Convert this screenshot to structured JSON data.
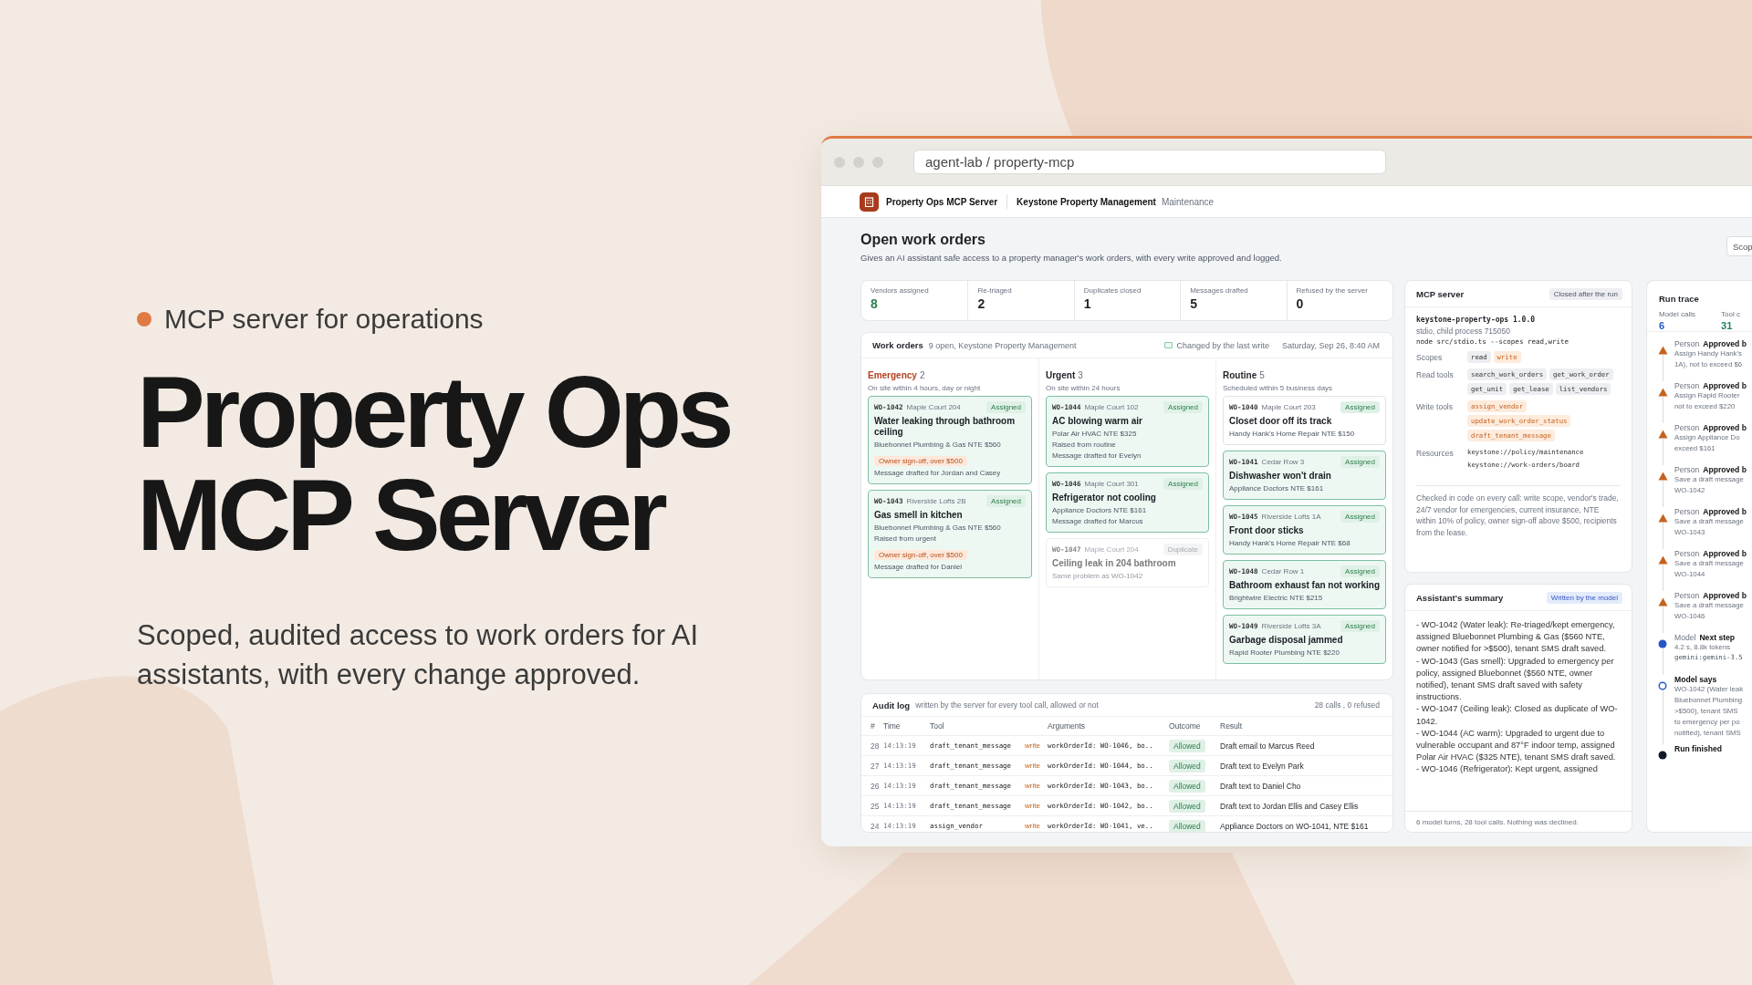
{
  "hero": {
    "eyebrow": "MCP server for operations",
    "title": "Property Ops MCP Server",
    "subtitle": "Scoped, audited access to work orders for AI assistants, with every change approved."
  },
  "window": {
    "url": "agent-lab / property-mcp"
  },
  "app_header": {
    "brand": "Property Ops MCP Server",
    "organization": "Keystone Property Management",
    "section": "Maintenance"
  },
  "page": {
    "title": "Open work orders",
    "description": "Gives an AI assistant safe access to a property manager's work orders, with every write approved and logged.",
    "scope_button": "Scop"
  },
  "stats": [
    {
      "label": "Vendors assigned",
      "value": "8",
      "color": "#2e7d4f"
    },
    {
      "label": "Re-triaged",
      "value": "2",
      "color": "#1f2329"
    },
    {
      "label": "Duplicates closed",
      "value": "1",
      "color": "#1f2329"
    },
    {
      "label": "Messages drafted",
      "value": "5",
      "color": "#1f2329"
    },
    {
      "label": "Refused by the server",
      "value": "0",
      "color": "#1f2329"
    }
  ],
  "work_orders": {
    "title": "Work orders",
    "summary": "9 open, Keystone Property Management",
    "legend": "Changed by the last write",
    "date": "Saturday, Sep 26, 8:40 AM",
    "columns": [
      {
        "name": "Emergency",
        "count": "2",
        "note": "On site within 4 hours, day or night",
        "color": "#b3401f",
        "cards": [
          {
            "id": "WO-1042",
            "location": "Maple Court 204",
            "status": "Assigned",
            "duplicate": false,
            "changed": true,
            "title": "Water leaking through bathroom ceiling",
            "lines": [
              {
                "kind": "text",
                "text": "Bluebonnet Plumbing & Gas NTE $560"
              },
              {
                "kind": "flag",
                "text": "Owner sign-off, over $500"
              },
              {
                "kind": "text",
                "text": "Message drafted for Jordan and Casey"
              }
            ]
          },
          {
            "id": "WO-1043",
            "location": "Riverside Lofts 2B",
            "status": "Assigned",
            "duplicate": false,
            "changed": true,
            "title": "Gas smell in kitchen",
            "lines": [
              {
                "kind": "text",
                "text": "Bluebonnet Plumbing & Gas NTE $560"
              },
              {
                "kind": "text",
                "text": "Raised from urgent"
              },
              {
                "kind": "flag",
                "text": "Owner sign-off, over $500"
              },
              {
                "kind": "text",
                "text": "Message drafted for Daniel"
              }
            ]
          }
        ]
      },
      {
        "name": "Urgent",
        "count": "3",
        "note": "On site within 24 hours",
        "color": "#1f2329",
        "cards": [
          {
            "id": "WO-1044",
            "location": "Maple Court 102",
            "status": "Assigned",
            "duplicate": false,
            "changed": true,
            "title": "AC blowing warm air",
            "lines": [
              {
                "kind": "text",
                "text": "Polar Air HVAC NTE $325"
              },
              {
                "kind": "text",
                "text": "Raised from routine"
              },
              {
                "kind": "text",
                "text": "Message drafted for Evelyn"
              }
            ]
          },
          {
            "id": "WO-1046",
            "location": "Maple Court 301",
            "status": "Assigned",
            "duplicate": false,
            "changed": true,
            "title": "Refrigerator not cooling",
            "lines": [
              {
                "kind": "text",
                "text": "Appliance Doctors NTE $161"
              },
              {
                "kind": "text",
                "text": "Message drafted for Marcus"
              }
            ]
          },
          {
            "id": "WO-1047",
            "location": "Maple Court 204",
            "status": "Duplicate",
            "duplicate": true,
            "changed": false,
            "title": "Ceiling leak in 204 bathroom",
            "lines": [
              {
                "kind": "text",
                "text": "Same problem as WO-1042"
              }
            ]
          }
        ]
      },
      {
        "name": "Routine",
        "count": "5",
        "note": "Scheduled within 5 business days",
        "color": "#1f2329",
        "cards": [
          {
            "id": "WO-1040",
            "location": "Maple Court 203",
            "status": "Assigned",
            "duplicate": false,
            "changed": false,
            "title": "Closet door off its track",
            "lines": [
              {
                "kind": "text",
                "text": "Handy Hank's Home Repair NTE $150"
              }
            ]
          },
          {
            "id": "WO-1041",
            "location": "Cedar Row 3",
            "status": "Assigned",
            "duplicate": false,
            "changed": true,
            "title": "Dishwasher won't drain",
            "lines": [
              {
                "kind": "text",
                "text": "Appliance Doctors NTE $161"
              }
            ]
          },
          {
            "id": "WO-1045",
            "location": "Riverside Lofts 1A",
            "status": "Assigned",
            "duplicate": false,
            "changed": true,
            "title": "Front door sticks",
            "lines": [
              {
                "kind": "text",
                "text": "Handy Hank's Home Repair NTE $68"
              }
            ]
          },
          {
            "id": "WO-1048",
            "location": "Cedar Row 1",
            "status": "Assigned",
            "duplicate": false,
            "changed": true,
            "title": "Bathroom exhaust fan not working",
            "lines": [
              {
                "kind": "text",
                "text": "Brightwire Electric NTE $215"
              }
            ]
          },
          {
            "id": "WO-1049",
            "location": "Riverside Lofts 3A",
            "status": "Assigned",
            "duplicate": false,
            "changed": true,
            "title": "Garbage disposal jammed",
            "lines": [
              {
                "kind": "text",
                "text": "Rapid Rooter Plumbing NTE $220"
              }
            ]
          }
        ]
      }
    ]
  },
  "audit_log": {
    "title": "Audit log",
    "subtitle": "written by the server for every tool call, allowed or not",
    "counts": "28 calls , 0 refused",
    "columns": [
      "#",
      "Time",
      "Tool",
      "Arguments",
      "Outcome",
      "Result"
    ],
    "rows": [
      {
        "number": "28",
        "time": "14:13:19",
        "tool": "draft_tenant_message",
        "scope": "write",
        "arguments": "workOrderId: WO-1046, bo..",
        "outcome": "Allowed",
        "result": "Draft email to Marcus Reed"
      },
      {
        "number": "27",
        "time": "14:13:19",
        "tool": "draft_tenant_message",
        "scope": "write",
        "arguments": "workOrderId: WO-1044, bo..",
        "outcome": "Allowed",
        "result": "Draft text to Evelyn Park"
      },
      {
        "number": "26",
        "time": "14:13:19",
        "tool": "draft_tenant_message",
        "scope": "write",
        "arguments": "workOrderId: WO-1043, bo..",
        "outcome": "Allowed",
        "result": "Draft text to Daniel Cho"
      },
      {
        "number": "25",
        "time": "14:13:19",
        "tool": "draft_tenant_message",
        "scope": "write",
        "arguments": "workOrderId: WO-1042, bo..",
        "outcome": "Allowed",
        "result": "Draft text to Jordan Ellis and Casey Ellis"
      },
      {
        "number": "24",
        "time": "14:13:19",
        "tool": "assign_vendor",
        "scope": "write",
        "arguments": "workOrderId: WO-1041, ve..",
        "outcome": "Allowed",
        "result": "Appliance Doctors on WO-1041, NTE $161"
      }
    ]
  },
  "mcp_server": {
    "title": "MCP server",
    "badge": "Closed after the run",
    "name": "keystone-property-ops 1.0.0",
    "process": "stdio, child process 715050",
    "command": "node src/stdio.ts --scopes read,write",
    "rows": [
      {
        "label": "Scopes",
        "items": [
          {
            "text": "read",
            "kind": "read"
          },
          {
            "text": "write",
            "kind": "write"
          }
        ]
      },
      {
        "label": "Read tools",
        "items": [
          {
            "text": "search_work_orders",
            "kind": "read"
          },
          {
            "text": "get_work_order",
            "kind": "read"
          },
          {
            "text": "get_unit",
            "kind": "read"
          },
          {
            "text": "get_lease",
            "kind": "read"
          },
          {
            "text": "list_vendors",
            "kind": "read"
          }
        ]
      },
      {
        "label": "Write tools",
        "items": [
          {
            "text": "assign_vendor",
            "kind": "write"
          },
          {
            "text": "update_work_order_status",
            "kind": "write"
          },
          {
            "text": "draft_tenant_message",
            "kind": "write"
          }
        ]
      },
      {
        "label": "Resources",
        "items": [
          {
            "text": "keystone://policy/maintenance",
            "kind": "plain"
          },
          {
            "text": "keystone://work-orders/board",
            "kind": "plain"
          }
        ]
      }
    ],
    "note": "Checked in code on every call: write scope, vendor's trade, 24/7 vendor for emergencies, current insurance, NTE within 10% of policy, owner sign-off above $500, recipients from the lease."
  },
  "summary": {
    "title": "Assistant's summary",
    "badge": "Written by the model",
    "lines": [
      "- WO-1042 (Water leak): Re-triaged/kept emergency, assigned Bluebonnet Plumbing & Gas ($560 NTE, owner notified for >$500), tenant SMS draft saved.",
      "- WO-1043 (Gas smell): Upgraded to emergency per policy, assigned Bluebonnet ($560 NTE, owner notified), tenant SMS draft saved with safety instructions.",
      "- WO-1047 (Ceiling leak): Closed as duplicate of WO-1042.",
      "- WO-1044 (AC warm): Upgraded to urgent due to vulnerable occupant and 87°F indoor temp, assigned Polar Air HVAC ($325 NTE), tenant SMS draft saved.",
      "- WO-1046 (Refrigerator): Kept urgent, assigned"
    ],
    "footer": "6 model turns, 28 tool calls. Nothing was declined."
  },
  "run_trace": {
    "title": "Run trace",
    "stats": [
      {
        "label": "Model calls",
        "value": "6",
        "color": "#2456c8"
      },
      {
        "label": "Tool c",
        "value": "31",
        "color": "#23806a"
      }
    ],
    "items": [
      {
        "kind": "person",
        "label": "Person",
        "title": "Approved b",
        "details": [
          "Assign Handy Hank's",
          "1A), not to exceed $6"
        ]
      },
      {
        "kind": "person",
        "label": "Person",
        "title": "Approved b",
        "details": [
          "Assign Rapid Rooter",
          "not to exceed $220"
        ]
      },
      {
        "kind": "person",
        "label": "Person",
        "title": "Approved b",
        "details": [
          "Assign Appliance Do",
          "exceed $161"
        ]
      },
      {
        "kind": "person",
        "label": "Person",
        "title": "Approved b",
        "details": [
          "Save a draft message",
          "WO-1042"
        ]
      },
      {
        "kind": "person",
        "label": "Person",
        "title": "Approved b",
        "details": [
          "Save a draft message",
          "WO-1043"
        ]
      },
      {
        "kind": "person",
        "label": "Person",
        "title": "Approved b",
        "details": [
          "Save a draft message",
          "WO-1044"
        ]
      },
      {
        "kind": "person",
        "label": "Person",
        "title": "Approved b",
        "details": [
          "Save a draft message",
          "WO-1046"
        ]
      },
      {
        "kind": "model",
        "label": "Model",
        "title": "Next step",
        "details": [
          "4.2 s, 8.8k tokens"
        ],
        "code": "gemini:gemini-3.5"
      },
      {
        "kind": "says",
        "title": "Model says",
        "details": [
          "WO-1042 (Water leak",
          "Bluebonnet Plumbing",
          ">$500), tenant SMS",
          "to emergency per po",
          "notified), tenant SMS"
        ]
      },
      {
        "kind": "end",
        "title": "Run finished"
      }
    ]
  }
}
